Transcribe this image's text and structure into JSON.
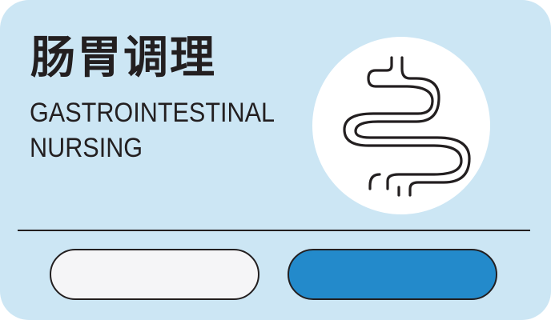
{
  "card": {
    "title_cn": "肠胃调理",
    "title_en_line1": "GASTROINTESTINAL",
    "title_en_line2": "NURSING",
    "icon": "intestine-icon"
  },
  "buttons": {
    "left_label": "",
    "right_label": ""
  },
  "colors": {
    "background": "#cce6f4",
    "accent": "#238acb",
    "light_button": "#f5f5f7",
    "ink": "#231f20"
  }
}
